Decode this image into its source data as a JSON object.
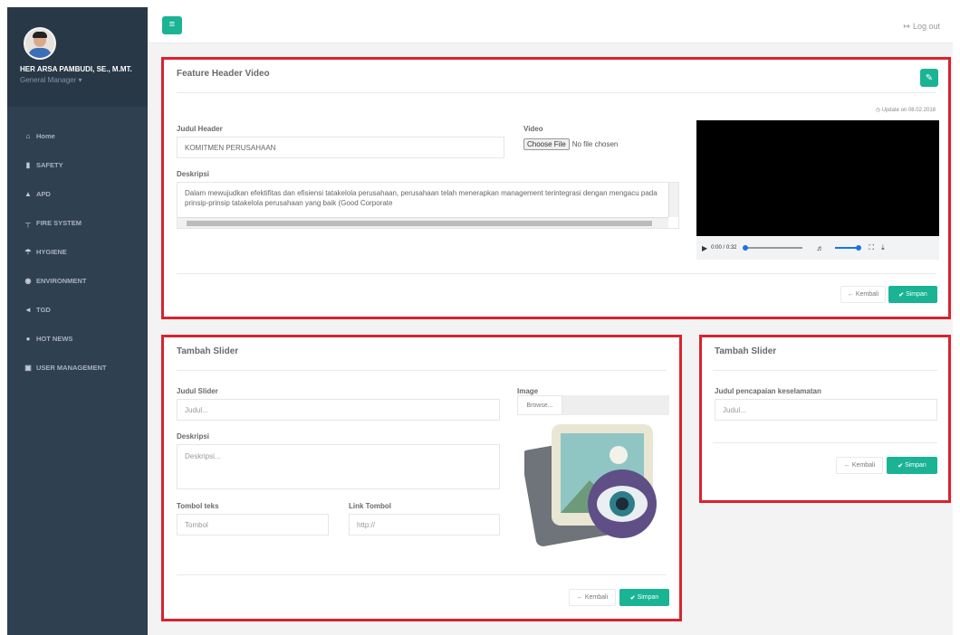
{
  "sidebar": {
    "profile_name": "HER ARSA PAMBUDI, SE., M.MT.",
    "profile_role": "General Manager ▾",
    "items": [
      {
        "label": "Home",
        "icon": "home-icon"
      },
      {
        "label": "SAFETY",
        "icon": "bar-chart-icon"
      },
      {
        "label": "APD",
        "icon": "user-icon"
      },
      {
        "label": "FIRE SYSTEM",
        "icon": "fire-extinguisher-icon"
      },
      {
        "label": "HYGIENE",
        "icon": "umbrella-icon"
      },
      {
        "label": "ENVIRONMENT",
        "icon": "leaf-icon"
      },
      {
        "label": "TGD",
        "icon": "bullhorn-icon"
      },
      {
        "label": "HOT NEWS",
        "icon": "globe-icon"
      },
      {
        "label": "USER MANAGEMENT",
        "icon": "lock-icon"
      }
    ]
  },
  "topbar": {
    "logout_label": "Log out"
  },
  "feature": {
    "title": "Feature Header Video",
    "update_text": "Update on 08.02.2018",
    "judul_label": "Judul Header",
    "judul_value": "KOMITMEN PERUSAHAAN",
    "video_label": "Video",
    "choose_file": "Choose File",
    "no_file": "No file chosen",
    "deskripsi_label": "Deskripsi",
    "deskripsi_value": "Dalam mewujudkan efektifitas dan efisiensi tatakelola perusahaan, perusahaan telah menerapkan management terintegrasi dengan mengacu pada prinsip-prinsip tatakelola perusahaan yang baik (Good Corporate",
    "video_time": "0:00 / 0:32",
    "kembali": "Kembali",
    "simpan": "Simpan"
  },
  "slider": {
    "title": "Tambah Slider",
    "judul_label": "Judul Slider",
    "judul_placeholder": "Judul...",
    "image_label": "Image",
    "browse": "Browse...",
    "deskripsi_label": "Deskripsi",
    "deskripsi_placeholder": "Deskripsi...",
    "tombol_label": "Tombol teks",
    "tombol_placeholder": "Tombol",
    "link_label": "Link Tombol",
    "link_placeholder": "http://",
    "kembali": "Kembali",
    "simpan": "Simpan"
  },
  "slider2": {
    "title": "Tambah Slider",
    "judul_label": "Judul pencapaian keselamatan",
    "judul_placeholder": "Judul...",
    "kembali": "Kembali",
    "simpan": "Simpan"
  },
  "colors": {
    "accent": "#1ab394",
    "sidebar": "#2f4050",
    "highlight_border": "#d9232e"
  }
}
